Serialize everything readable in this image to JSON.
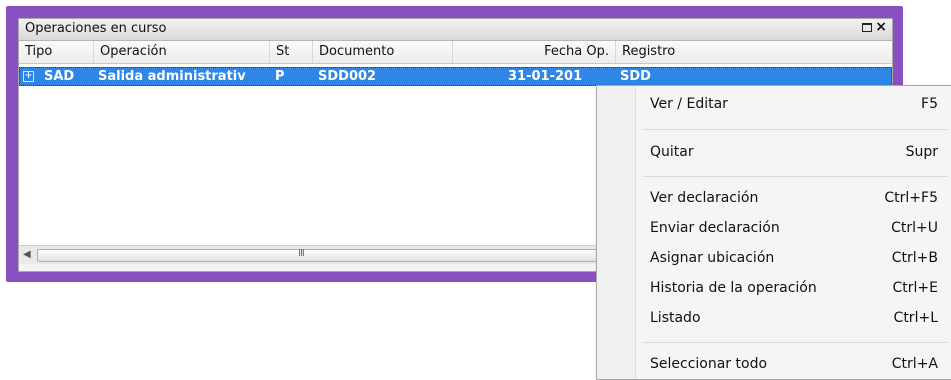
{
  "panel": {
    "title": "Operaciones en curso",
    "columns": [
      "Tipo",
      "Operación",
      "St",
      "Documento",
      "Fecha Op.",
      "Registro"
    ],
    "rows": [
      {
        "tipo": "SAD",
        "operacion": "Salida administratiᴠ",
        "st": "P",
        "documento": "SDD002",
        "fecha": "31-01-201",
        "registro": "SDD"
      }
    ],
    "scroll_grip": "III"
  },
  "context_menu": {
    "items": [
      {
        "label": "Ver / Editar",
        "shortcut": "F5"
      },
      {
        "label": "Quitar",
        "shortcut": "Supr"
      },
      {
        "label": "Ver declaración",
        "shortcut": "Ctrl+F5"
      },
      {
        "label": "Enviar declaración",
        "shortcut": "Ctrl+U"
      },
      {
        "label": "Asignar ubicación",
        "shortcut": "Ctrl+B"
      },
      {
        "label": "Historia de la operación",
        "shortcut": "Ctrl+E"
      },
      {
        "label": "Listado",
        "shortcut": "Ctrl+L"
      },
      {
        "label": "Seleccionar todo",
        "shortcut": "Ctrl+A"
      }
    ]
  },
  "colors": {
    "accent_frame": "#8a4fc0",
    "selection": "#2f86e6"
  }
}
